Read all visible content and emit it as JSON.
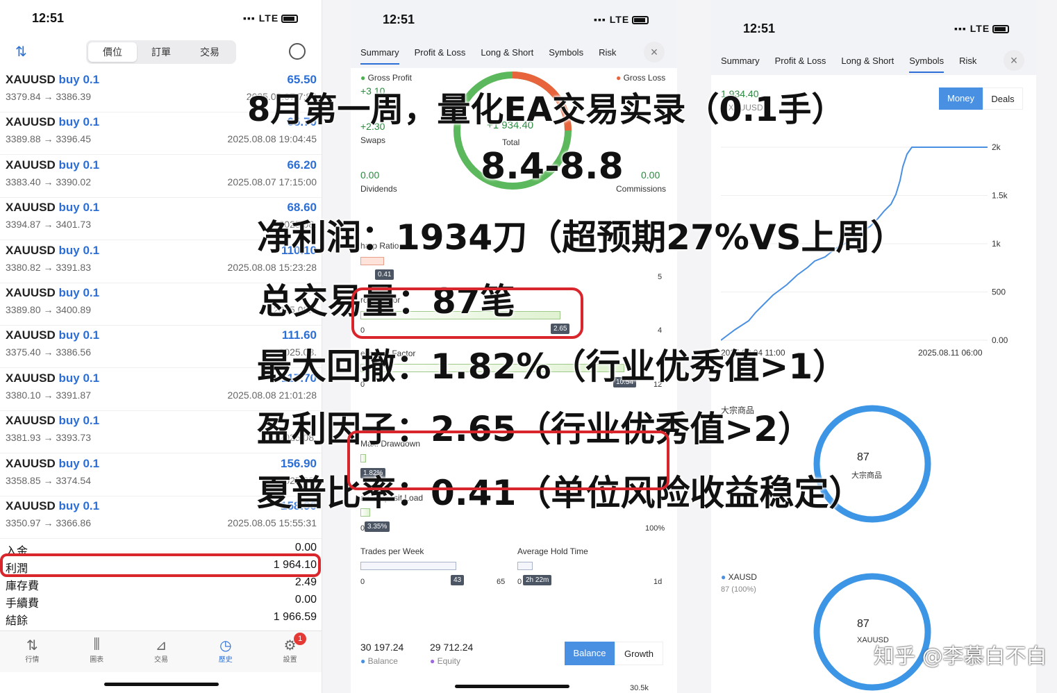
{
  "status": {
    "time": "12:51",
    "network": "LTE"
  },
  "p1": {
    "segments": [
      "價位",
      "訂單",
      "交易"
    ],
    "trades": [
      {
        "symbol": "XAUUSD",
        "side": "buy 0.1",
        "prices": "3379.84 → 3386.39",
        "profit": "65.50",
        "date": "2025.08.07 7:80"
      },
      {
        "symbol": "XAUUSD",
        "side": "buy 0.1",
        "prices": "3389.88 → 3396.45",
        "profit": "65.70",
        "date": "2025.08.08 19:04:45"
      },
      {
        "symbol": "XAUUSD",
        "side": "buy 0.1",
        "prices": "3383.40 → 3390.02",
        "profit": "66.20",
        "date": "2025.08.07 17:15:00"
      },
      {
        "symbol": "XAUUSD",
        "side": "buy 0.1",
        "prices": "3394.87 → 3401.73",
        "profit": "68.60",
        "date": "2025.08."
      },
      {
        "symbol": "XAUUSD",
        "side": "buy 0.1",
        "prices": "3380.82 → 3391.83",
        "profit": "110.10",
        "date": "2025.08.08 15:23:28"
      },
      {
        "symbol": "XAUUSD",
        "side": "buy 0.1",
        "prices": "3389.80 → 3400.89",
        "profit": "",
        "date": "2025.08.0"
      },
      {
        "symbol": "XAUUSD",
        "side": "buy 0.1",
        "prices": "3375.40 → 3386.56",
        "profit": "111.60",
        "date": "2025.08."
      },
      {
        "symbol": "XAUUSD",
        "side": "buy 0.1",
        "prices": "3380.10 → 3391.87",
        "profit": "117.70",
        "date": "2025.08.08 21:01:28"
      },
      {
        "symbol": "XAUUSD",
        "side": "buy 0.1",
        "prices": "3381.93 → 3393.73",
        "profit": "",
        "date": "2025.08."
      },
      {
        "symbol": "XAUUSD",
        "side": "buy 0.1",
        "prices": "3358.85 → 3374.54",
        "profit": "156.90",
        "date": "2025.08."
      },
      {
        "symbol": "XAUUSD",
        "side": "buy 0.1",
        "prices": "3350.97 → 3366.86",
        "profit": "158.90",
        "date": "2025.08.05 15:55:31"
      }
    ],
    "summary": [
      {
        "label": "入金",
        "value": "0.00"
      },
      {
        "label": "利潤",
        "value": "1 964.10"
      },
      {
        "label": "庫存費",
        "value": "2.49"
      },
      {
        "label": "手續費",
        "value": "0.00"
      },
      {
        "label": "結餘",
        "value": "1 966.59"
      }
    ],
    "tabbar": [
      "行情",
      "圖表",
      "交易",
      "歷史",
      "設置"
    ],
    "badge": "1"
  },
  "p2": {
    "tabs": [
      "Summary",
      "Profit & Loss",
      "Long & Short",
      "Symbols",
      "Risk"
    ],
    "gross_profit_label": "Gross Profit",
    "gross_profit": "+3 10",
    "gross_loss_label": "Gross Loss",
    "swaps": "+2.30",
    "swaps_label": "Swaps",
    "total": "+1 934.40",
    "total_label": "Total",
    "dividends": "0.00",
    "dividends_label": "Dividends",
    "commissions": "0.00",
    "commissions_label": "Commissions",
    "sharp_label": "harp Ratio",
    "sharp_val": "0.41",
    "sharp_max": "5",
    "pf_label": "rofit Factor",
    "pf_val": "2.65",
    "pf_min": "0",
    "pf_max": "4",
    "rf_label": "ecovery Factor",
    "rf_val": "10.54",
    "rf_min": "0",
    "rf_max": "12",
    "dd_label": "Max. Drawdown",
    "dd_val": "1.82%",
    "dl_label": "ax. Deposit Load",
    "dl_val": "3.35%",
    "dl_min": "0",
    "dl_max": "100%",
    "tpw_label": "Trades per Week",
    "tpw_val": "43",
    "tpw_min": "0",
    "tpw_max": "65",
    "aht_label": "Average Hold Time",
    "aht_val": "2h 22m",
    "aht_min": "0",
    "aht_max": "1d",
    "balance": "30 197.24",
    "balance_label": "Balance",
    "equity": "29 712.24",
    "equity_label": "Equity",
    "btn_balance": "Balance",
    "btn_growth": "Growth",
    "bottom_tick": "30.5k"
  },
  "p3": {
    "tabs": [
      "Summary",
      "Profit & Loss",
      "Long & Short",
      "Symbols",
      "Risk"
    ],
    "header_val": "1 934.40",
    "legend": "XAUUSD",
    "btn_money": "Money",
    "btn_deals": "Deals",
    "yticks": [
      "2k",
      "1.5k",
      "1k",
      "500",
      "0.00"
    ],
    "xtick1": "2025.08.04 11:00",
    "xtick2": "2025.08.11 06:00",
    "donut1_title": "大宗商品",
    "donut1_val": "87",
    "donut1_sub": "大宗商品",
    "legend2": "XAUSD",
    "legend2_sub": "87 (100%)",
    "donut2_val": "87",
    "donut2_sub": "XAUUSD",
    "watermark": "知乎 @李慕白不白"
  },
  "overlay": {
    "title": "8月第一周，量化EA交易实录（0.1手）",
    "dates": "8.4-8.8",
    "profit": "净利润：1934刀（超预期27%VS上周）",
    "trades": "总交易量：87笔",
    "drawdown": "最大回撤：1.82%（行业优秀值>1）",
    "pf": "盈利因子：2.65（行业优秀值>2）",
    "sharpe": "夏普比率：0.41（单位风险收益稳定）"
  },
  "colors": {
    "accent": "#2b6fd6",
    "red_box": "#d9262c",
    "green": "#4caf50",
    "orange": "#e8643c",
    "chart_blue": "#4a90e2"
  }
}
